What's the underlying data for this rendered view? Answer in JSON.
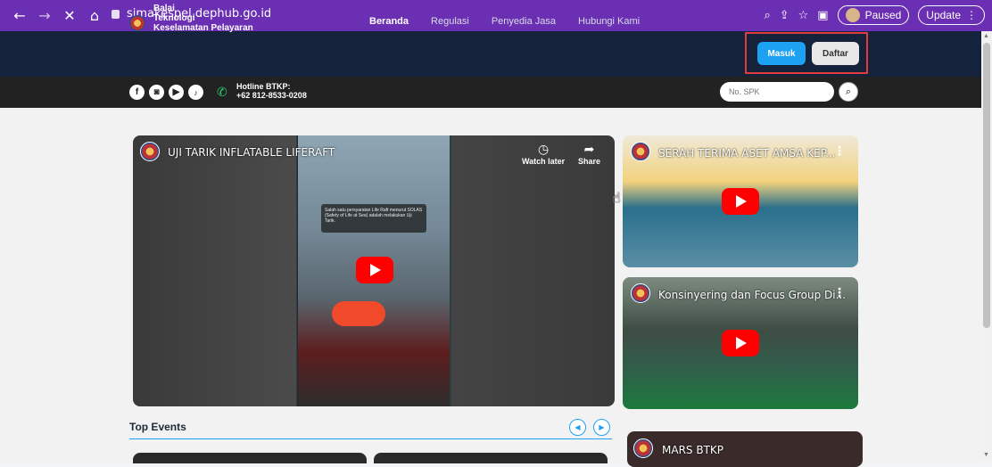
{
  "browser": {
    "back": "←",
    "forward": "→",
    "close": "✕",
    "home": "⌂",
    "url": "simakespel.dephub.go.id",
    "paused_label": "Paused",
    "update_label": "Update"
  },
  "header": {
    "brand_line1": "Balai",
    "brand_line2": "Teknologi",
    "brand_line3": "Keselamatan Pelayaran",
    "nav": [
      "Beranda",
      "Regulasi",
      "Penyedia Jasa",
      "Hubungi Kami"
    ],
    "active_nav": "Beranda",
    "login_label": "Masuk",
    "register_label": "Daftar"
  },
  "subheader": {
    "hotline_label": "Hotline BTKP:",
    "hotline_number": "+62 812-8533-0208",
    "spk_placeholder": "No. SPK"
  },
  "videos": {
    "main": {
      "title": "UJI TARIK INFLATABLE LIFERAFT",
      "watch_later": "Watch later",
      "share": "Share",
      "caption": "Salah satu persyaratan Life Raft menurut SOLAS (Safety of Life at Sea) adalah melakukan Uji Tarik."
    },
    "side1": {
      "title": "SERAH TERIMA ASET AMSA KEP..."
    },
    "side2": {
      "title": "Konsinyering dan Focus Group Di..."
    },
    "side3": {
      "title": "MARS BTKP"
    }
  },
  "events": {
    "heading": "Top Events"
  },
  "colors": {
    "browser_chrome": "#6b2fb3",
    "header_bg": "#14233b",
    "subheader_bg": "#222222",
    "accent": "#1da1f2",
    "highlight_box": "#e23b3b"
  }
}
